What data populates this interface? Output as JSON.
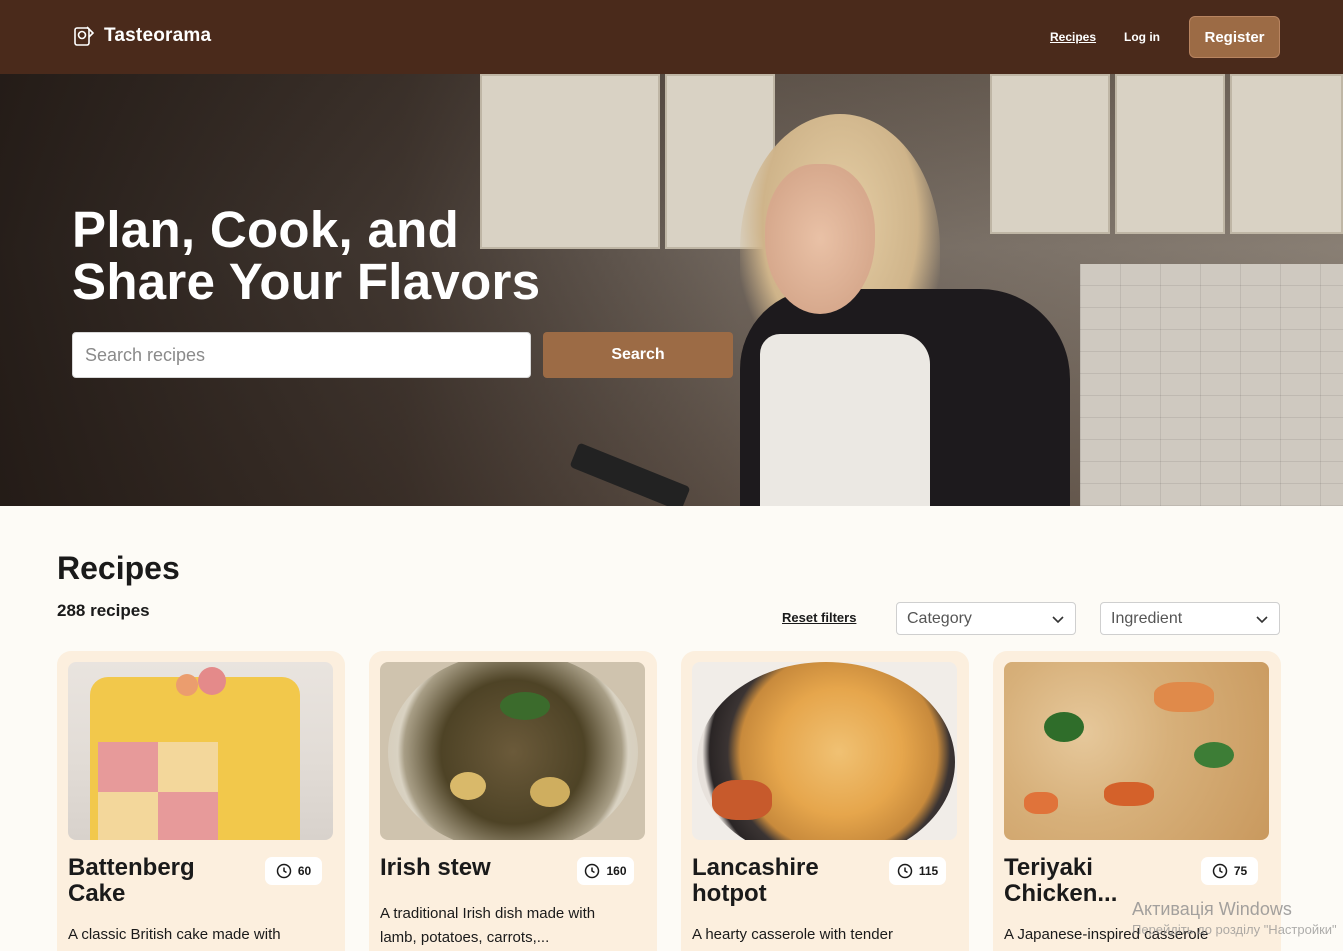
{
  "header": {
    "brand": "Tasteorama",
    "nav_recipes": "Recipes",
    "nav_login": "Log in",
    "register": "Register"
  },
  "hero": {
    "title_line1": "Plan, Cook, and",
    "title_line2": "Share Your Flavors",
    "search_placeholder": "Search recipes",
    "search_button": "Search"
  },
  "recipes": {
    "title": "Recipes",
    "count_text": "288 recipes",
    "reset_filters": "Reset filters",
    "category_placeholder": "Category",
    "ingredient_placeholder": "Ingredient",
    "cards": [
      {
        "title": "Battenberg Cake",
        "time": "60",
        "description": "A classic British cake made with"
      },
      {
        "title": "Irish stew",
        "time": "160",
        "description": "A traditional Irish dish made with lamb, potatoes, carrots,..."
      },
      {
        "title": "Lancashire hotpot",
        "time": "115",
        "description": "A hearty casserole with tender"
      },
      {
        "title": "Teriyaki Chicken...",
        "time": "75",
        "description": "A Japanese-inspired casserole"
      }
    ]
  },
  "os_watermark": {
    "line1": "Активація Windows",
    "line2": "Перейдіть до розділу \"Настройки\""
  },
  "colors": {
    "header_bg": "#4a2a1b",
    "accent_brown": "#9c6b45",
    "card_bg": "#fcefde",
    "page_bg": "#fdfbf6"
  }
}
